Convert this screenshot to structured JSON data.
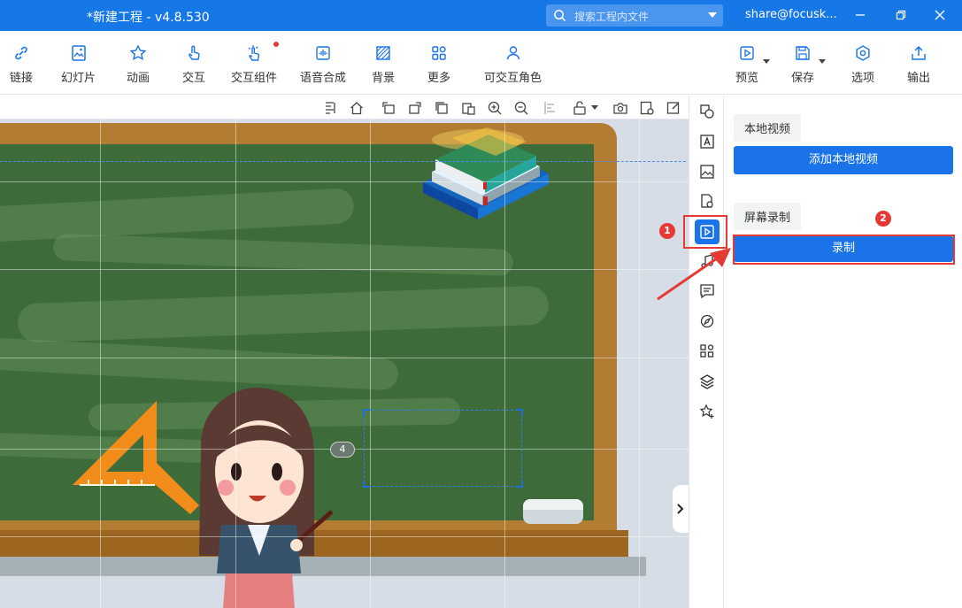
{
  "app": {
    "title": "*新建工程 - v4.8.530",
    "search_placeholder": "搜索工程内文件",
    "user": "share@focusk..."
  },
  "window_controls": [
    "minimize-icon",
    "restore-icon",
    "close-icon"
  ],
  "toolbar": {
    "left_items": [
      {
        "label": "链接",
        "icon": "link-icon"
      },
      {
        "label": "幻灯片",
        "icon": "slides-icon"
      },
      {
        "label": "动画",
        "icon": "star-animation-icon"
      },
      {
        "label": "交互",
        "icon": "hand-pointer-icon"
      },
      {
        "label": "交互组件",
        "icon": "interactive-component-icon",
        "has_notification_dot": true
      },
      {
        "label": "语音合成",
        "icon": "voice-synthesis-icon"
      },
      {
        "label": "背景",
        "icon": "background-icon"
      },
      {
        "label": "更多",
        "icon": "more-grid-icon"
      },
      {
        "label": "可交互角色",
        "icon": "interactive-character-icon"
      }
    ],
    "right_items": [
      {
        "label": "预览",
        "icon": "preview-play-icon",
        "dropdown": true
      },
      {
        "label": "保存",
        "icon": "save-disk-icon",
        "dropdown": true
      },
      {
        "label": "选项",
        "icon": "options-gear-icon"
      },
      {
        "label": "输出",
        "icon": "export-upload-icon"
      }
    ]
  },
  "canvas": {
    "frame_badge": "4"
  },
  "side_icons": [
    "shape-icon",
    "text-icon",
    "image-icon",
    "file-icon",
    "video-icon",
    "music-icon",
    "comment-icon",
    "compass-icon",
    "widgets-icon",
    "layers-icon",
    "star-plus-icon"
  ],
  "panel": {
    "local_video_label": "本地视频",
    "add_local_video_button": "添加本地视频",
    "screen_record_label": "屏幕录制",
    "record_button": "录制"
  },
  "annotations": {
    "step1": "1",
    "step2": "2",
    "highlight_color": "#e53935"
  },
  "colors": {
    "accent": "#1a73e8",
    "titlebar": "#1677e6",
    "board_green": "#3d6b3a",
    "board_frame": "#b27c33"
  }
}
